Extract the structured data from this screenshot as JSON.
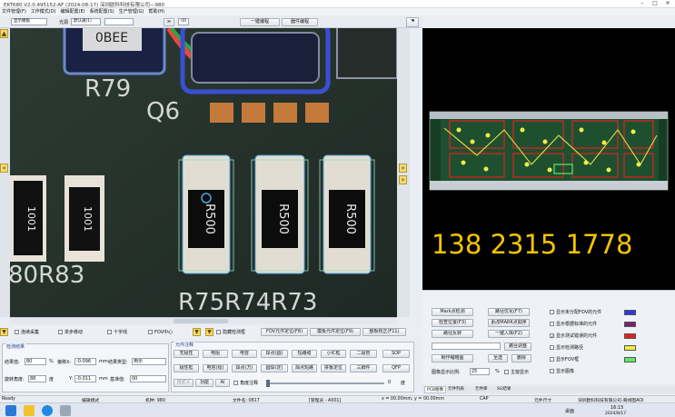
{
  "window": {
    "title": "EKT680 V2.0.495152-AF (2024-08-17) 深圳欧科科技有限公司—980"
  },
  "menu": [
    "文件管理(F)",
    "工作模式(D)",
    "编辑配置(E)",
    "系统配置(S)",
    "生产管理(G)",
    "帮助(H)"
  ],
  "toolbar": {
    "mode": "显示模板",
    "light_label": "光源",
    "light_value": "默认通(1)",
    "one_key": "一键编程",
    "review": "器件编程",
    "pos_box": "(0)"
  },
  "camera": {
    "labels": [
      "R79",
      "Q6",
      "80R83",
      "R75R74R73",
      "0BEE"
    ],
    "resistors": [
      "R500",
      "R500",
      "R500"
    ],
    "left_chips": [
      "1001",
      "1001"
    ]
  },
  "options": {
    "a": "连续采集",
    "b": "单步移动",
    "c": "十字线",
    "d": "FOV中心",
    "e": "隐藏检测框",
    "btns": [
      "FOV元件定位(F8)",
      "模板元件定位(F9)",
      "整板校正(F11)"
    ]
  },
  "detect": {
    "title": "检测结果",
    "result_label": "结果值:",
    "result": "80",
    "pct": "%",
    "offx_label": "偏移X:",
    "offx": "-0.096",
    "mm": "mm",
    "type_label": "结果类型:",
    "type": "用示",
    "angle_label": "旋转角度:",
    "angle": "88",
    "deg": "度",
    "y_label": "Y:",
    "y": "-0.011",
    "base_label": "基准值:",
    "base": "00"
  },
  "comp": {
    "title": "元件注释",
    "row1": [
      "无极性",
      "电阻",
      "电容",
      "焊点(圆)",
      "短路缝",
      "小IC框",
      "二极管",
      "SOP"
    ],
    "row2": [
      "极性框",
      "电容(钽)",
      "焊点(方)",
      "圆焊(定)",
      "焊点短路",
      "拼板定位",
      "三脚件",
      "QFP"
    ],
    "row3": [
      "自定义",
      "功能",
      "AI"
    ],
    "check": "角度注释",
    "zero": "0",
    "deg": "度"
  },
  "pcb": {
    "phone": "138 2315 1778"
  },
  "rpanel": {
    "btns": [
      "Mark点检测",
      "路径优化(F7)",
      "检查位置(F3)",
      "更改MARK点顺序",
      "路径反转",
      "一键入库(F2)",
      "路径调整",
      "制作缩略图",
      "全选",
      "删除"
    ],
    "zoom_label": "图像显示比例:",
    "zoom": "25",
    "pct": "%",
    "main": "主窗显示",
    "legend": [
      {
        "t": "显示未分配FOV的元件",
        "c": "#2f39e0"
      },
      {
        "t": "显示根据标准的元件",
        "c": "#7a2070"
      },
      {
        "t": "显示测试错误的元件",
        "c": "#e22020"
      },
      {
        "t": "显示检测路径",
        "c": "#f1ec46"
      },
      {
        "t": "显示FOV框",
        "c": "#5ee95e"
      },
      {
        "t": "显示图像",
        "c": ""
      }
    ]
  },
  "tabs": [
    "PCB图像",
    "元件列表",
    "元件库",
    "SG结果"
  ],
  "status": [
    "Ready",
    "编辑模式",
    "机种: 980",
    "文件名: 0817",
    "[管理员 - A001]",
    "x = 00.00mm, y = 00.00mm",
    "CAP",
    "元件尺寸",
    "深圳欧科科技有限公司-离线图AOI"
  ],
  "taskbar": {
    "time": "16:15",
    "date": "2024/8/17",
    "desktop": "桌面"
  }
}
